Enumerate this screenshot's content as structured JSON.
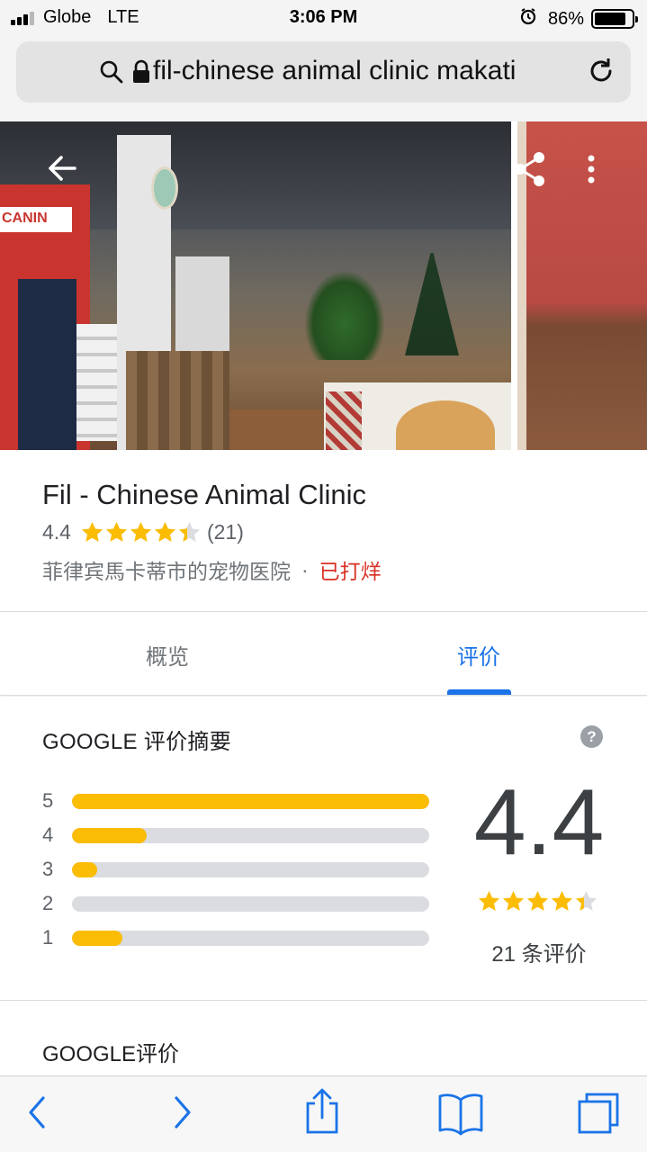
{
  "status_bar": {
    "carrier": "Globe",
    "network": "LTE",
    "time": "3:06 PM",
    "battery": "86%",
    "battery_level": 0.86
  },
  "browser": {
    "url_text": "fil-chinese animal clinic makati"
  },
  "gallery": {
    "photo_sign_text": "CANIN"
  },
  "place": {
    "name": "Fil - Chinese Animal Clinic",
    "rating": "4.4",
    "rating_value": 4.4,
    "review_count_paren": "(21)",
    "category": "菲律宾馬卡蒂市的宠物医院",
    "separator": "·",
    "status": "已打烊",
    "status_color": "#d93025"
  },
  "tabs": [
    {
      "label": "概览",
      "active": false
    },
    {
      "label": "评价",
      "active": true
    }
  ],
  "summary": {
    "title": "GOOGLE 评价摘要",
    "help_symbol": "?",
    "distribution": [
      {
        "stars": "5",
        "fraction": 1.0
      },
      {
        "stars": "4",
        "fraction": 0.21
      },
      {
        "stars": "3",
        "fraction": 0.07
      },
      {
        "stars": "2",
        "fraction": 0.0
      },
      {
        "stars": "1",
        "fraction": 0.14
      }
    ],
    "score": "4.4",
    "review_total": "21 条评价"
  },
  "google_reviews": {
    "title": "GOOGLE评价"
  },
  "colors": {
    "accent_blue": "#1a73e8",
    "star_yellow": "#fbbc04",
    "track_gray": "#dadce0"
  },
  "icons": {
    "back": "arrow-left-icon",
    "share": "share-icon",
    "more": "more-vert-icon",
    "search": "search-icon",
    "lock": "lock-icon",
    "reload": "reload-icon",
    "toolbar": [
      "chevron-left-icon",
      "chevron-right-icon",
      "share-icon",
      "bookmarks-icon",
      "tabs-icon"
    ]
  }
}
